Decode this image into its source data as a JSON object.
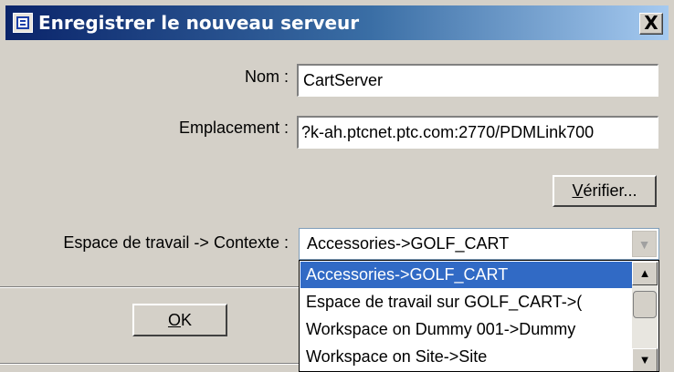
{
  "window": {
    "title": "Enregistrer le nouveau serveur",
    "close_glyph": "X"
  },
  "form": {
    "name_label": "Nom :",
    "name_value": "CartServer",
    "location_label": "Emplacement :",
    "location_value": "?k-ah.ptcnet.ptc.com:2770/PDMLink700",
    "verify_button": {
      "underlined": "V",
      "rest": "érifier..."
    },
    "context_label": "Espace de travail -> Contexte :",
    "context_selected": "Accessories->GOLF_CART",
    "context_options": [
      "Accessories->GOLF_CART",
      "Espace de travail sur GOLF_CART->(",
      "Workspace on Dummy 001->Dummy",
      "Workspace on Site->Site"
    ]
  },
  "footer": {
    "ok_button": {
      "underlined": "O",
      "rest": "K"
    }
  },
  "colors": {
    "dialog_bg": "#d4d0c8",
    "title_gradient_start": "#0a246a",
    "title_gradient_end": "#a6caf0",
    "selection": "#316ac5"
  },
  "icons": {
    "title": "window-app-icon",
    "combo_arrow": "chevron-down-icon",
    "scroll_up": "arrow-up-icon",
    "scroll_down": "arrow-down-icon"
  }
}
